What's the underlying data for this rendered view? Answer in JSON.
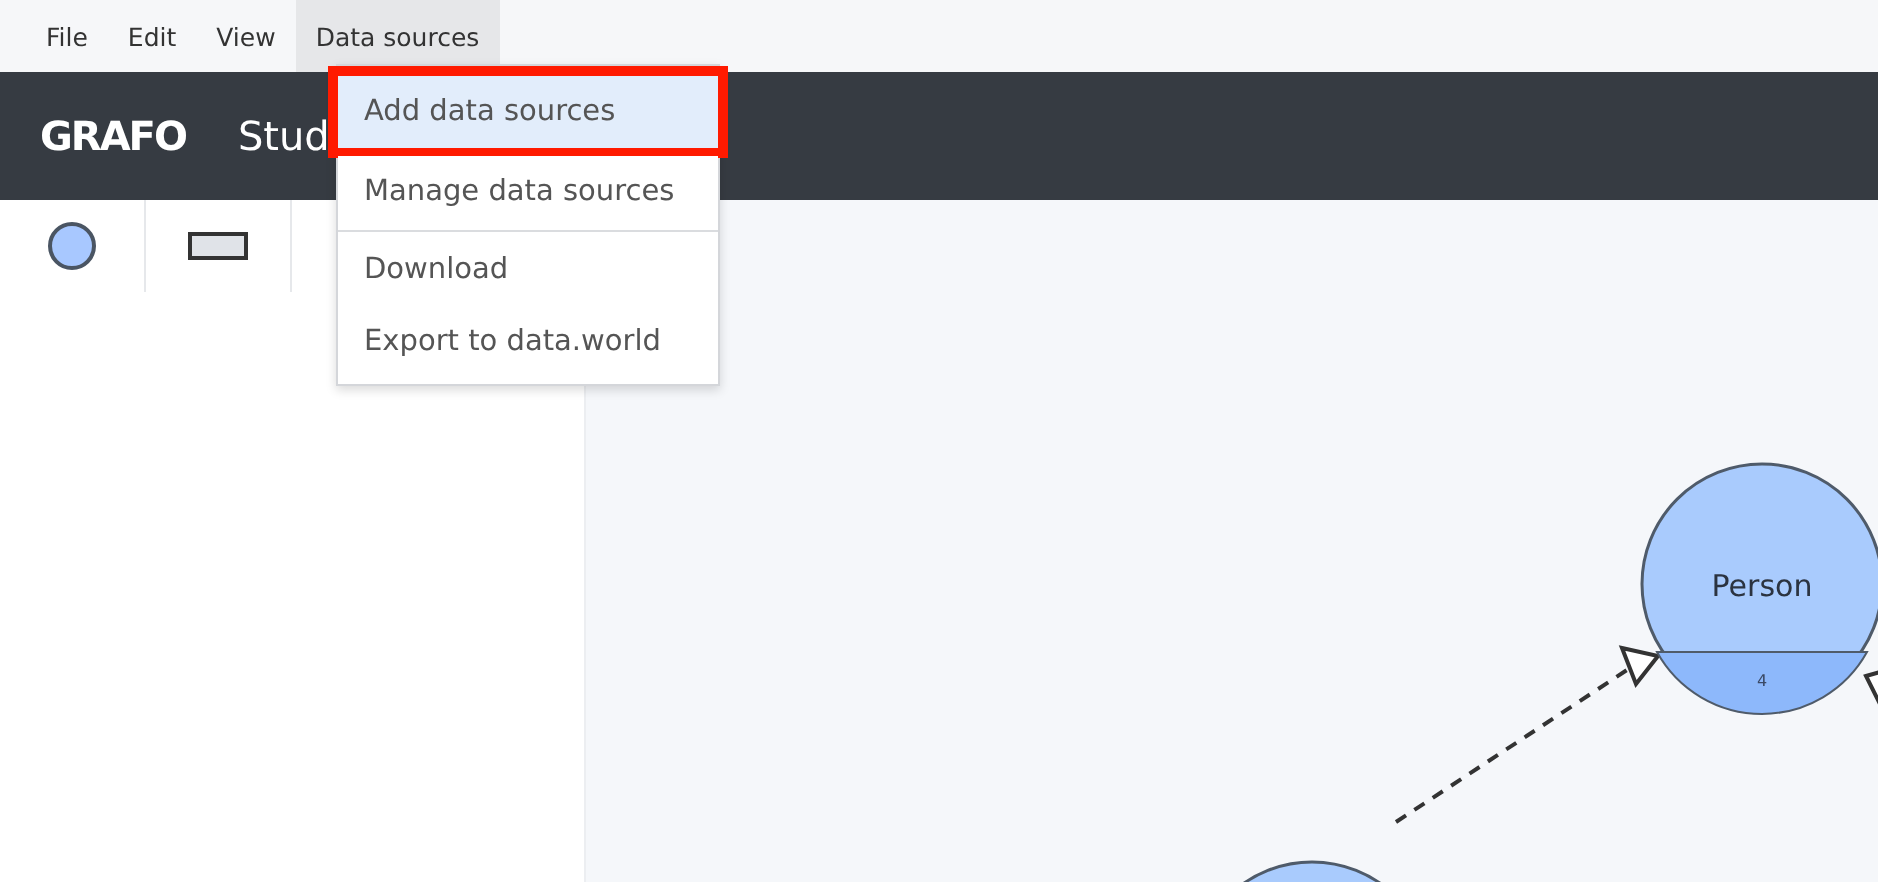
{
  "menu_bar": [
    {
      "label": "File",
      "open": false
    },
    {
      "label": "Edit",
      "open": false
    },
    {
      "label": "View",
      "open": false
    },
    {
      "label": "Data sources",
      "open": true
    }
  ],
  "dropdown": [
    {
      "label": "Add data sources",
      "selected": true
    },
    {
      "label": "Manage data sources",
      "selected": false,
      "divider_after": true
    },
    {
      "label": "Download",
      "selected": false
    },
    {
      "label": "Export to data.world",
      "selected": false
    }
  ],
  "header": {
    "logo": "GRAFO",
    "title": "Stud"
  },
  "toolbar": [
    {
      "kind": "circle"
    },
    {
      "kind": "rectangle"
    }
  ],
  "canvas": {
    "nodes": [
      {
        "label": "Person",
        "count": "4"
      }
    ]
  }
}
